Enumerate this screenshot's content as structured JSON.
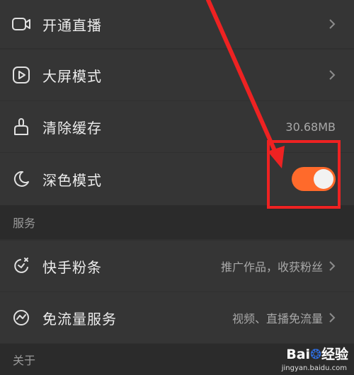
{
  "settings": {
    "items": [
      {
        "label": "开通直播",
        "icon": "video-camera-icon"
      },
      {
        "label": "大屏模式",
        "icon": "play-screen-icon"
      },
      {
        "label": "清除缓存",
        "icon": "broom-icon",
        "value": "30.68MB"
      },
      {
        "label": "深色模式",
        "icon": "moon-icon",
        "toggle_on": true
      }
    ]
  },
  "services": {
    "header": "服务",
    "items": [
      {
        "label": "快手粉条",
        "icon": "rocket-icon",
        "value": "推广作品，收获粉丝"
      },
      {
        "label": "免流量服务",
        "icon": "traffic-icon",
        "value": "视频、直播免流量"
      }
    ]
  },
  "about": {
    "header": "关于"
  },
  "watermark": {
    "brand_left": "Bai",
    "brand_right": "经验",
    "url": "jingyan.baidu.com"
  },
  "colors": {
    "toggle_on": "#ff6a2b",
    "annotation": "#ee2222",
    "background": "#353535"
  }
}
